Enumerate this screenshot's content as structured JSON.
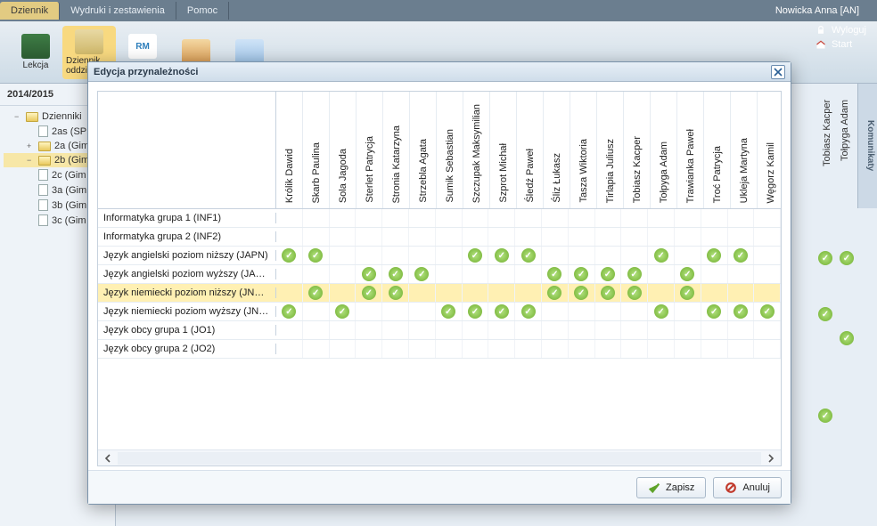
{
  "topbar": {
    "tabs": [
      "Dziennik",
      "Wydruki i zestawienia",
      "Pomoc"
    ],
    "active": 0,
    "user": "Nowicka Anna [AN]"
  },
  "ribbon": {
    "items": [
      {
        "label": "Lekcja"
      },
      {
        "label": "Dziennik oddziału"
      },
      {
        "label": "RM"
      },
      {
        "label": ""
      },
      {
        "label": ""
      }
    ],
    "right": {
      "logout": "Wyloguj",
      "start": "Start"
    }
  },
  "sidebar": {
    "year": "2014/2015",
    "root": "Dzienniki",
    "items": [
      {
        "label": "2as (SP",
        "type": "file"
      },
      {
        "label": "2a (Gim",
        "type": "folder",
        "toggle": "+"
      },
      {
        "label": "2b (Gim",
        "type": "folder",
        "toggle": "−",
        "selected": true
      },
      {
        "label": "2c (Gim",
        "type": "file"
      },
      {
        "label": "3a (Gim",
        "type": "file"
      },
      {
        "label": "3b (Gim",
        "type": "file"
      },
      {
        "label": "3c (Gim",
        "type": "file"
      }
    ]
  },
  "bg": {
    "cols": [
      "Tobiasz Kacper",
      "Tołpyga Adam"
    ]
  },
  "komunikaty": "Komunikaty",
  "modal": {
    "title": "Edycja przynależności",
    "columns": [
      "Królik Dawid",
      "Skarb Paulina",
      "Sola Jagoda",
      "Sterlet Patrycja",
      "Stronia Katarzyna",
      "Strzebla Agata",
      "Sumik Sebastian",
      "Szczupak Maksymilian",
      "Szprot Michał",
      "Śledź Paweł",
      "Śliz Łukasz",
      "Tasza Wiktoria",
      "Tirlapia Juliusz",
      "Tobiasz Kacper",
      "Tołpyga Adam",
      "Trawianka Paweł",
      "Troć Patrycja",
      "Ukleja Martyna",
      "Węgorz Kamil"
    ],
    "rows": [
      {
        "label": "Informatyka grupa 1 (INF1)",
        "checks": []
      },
      {
        "label": "Informatyka grupa 2 (INF2)",
        "checks": []
      },
      {
        "label": "Język angielski poziom niższy (JAPN)",
        "checks": [
          0,
          1,
          7,
          8,
          9,
          14,
          16,
          17
        ]
      },
      {
        "label": "Język angielski poziom wyższy (JAPW)",
        "checks": [
          3,
          4,
          5,
          10,
          11,
          12,
          13,
          15
        ]
      },
      {
        "label": "Język niemiecki poziom niższy (JNPN)",
        "checks": [
          1,
          3,
          4,
          10,
          11,
          12,
          13,
          15
        ],
        "selected": true
      },
      {
        "label": "Język niemiecki poziom wyższy (JNP...",
        "checks": [
          0,
          2,
          6,
          7,
          8,
          9,
          14,
          16,
          17,
          18
        ]
      },
      {
        "label": "Język obcy grupa 1 (JO1)",
        "checks": []
      },
      {
        "label": "Język obcy grupa 2 (JO2)",
        "checks": []
      }
    ],
    "save": "Zapisz",
    "cancel": "Anuluj"
  }
}
